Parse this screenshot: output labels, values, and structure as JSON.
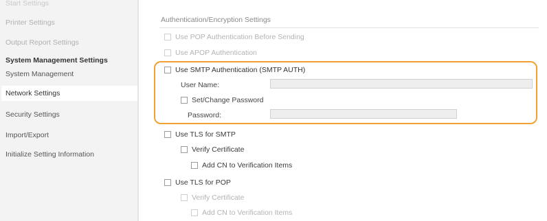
{
  "sidebar": {
    "top_cut": "Start Settings",
    "items_before": [
      "Printer Settings",
      "Output Report Settings"
    ],
    "heading": "System Management Settings",
    "items": [
      "System Management",
      "Network Settings",
      "Security Settings",
      "Import/Export",
      "Initialize Setting Information"
    ],
    "selected": "Network Settings"
  },
  "main": {
    "section_title": "Authentication/Encryption Settings",
    "pop_auth": "Use POP Authentication Before Sending",
    "apop_auth": "Use APOP Authentication",
    "smtp_auth": "Use SMTP Authentication (SMTP AUTH)",
    "user_name_label": "User Name:",
    "set_change_password": "Set/Change Password",
    "password_label": "Password:",
    "use_tls_smtp": "Use TLS for SMTP",
    "verify_cert_1": "Verify Certificate",
    "add_cn_1": "Add CN to Verification Items",
    "use_tls_pop": "Use TLS for POP",
    "verify_cert_2": "Verify Certificate",
    "add_cn_2": "Add CN to Verification Items",
    "user_name_value": "",
    "password_value": ""
  },
  "colors": {
    "highlight": "#f0a130",
    "sidebar_bg": "#f3f3f3"
  }
}
